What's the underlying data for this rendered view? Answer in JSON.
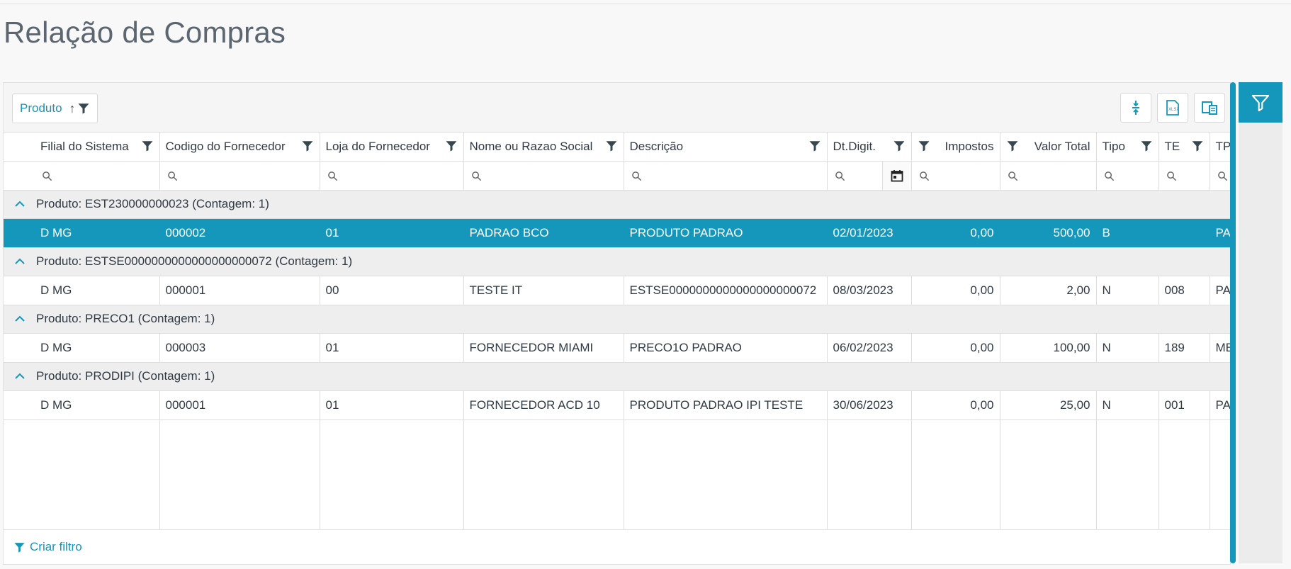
{
  "page": {
    "title": "Relação de Compras"
  },
  "toolbar": {
    "group_chip": {
      "label": "Produto",
      "sort_glyph": "↑"
    },
    "buttons": [
      "collapse-rows-icon",
      "export-xlsx-icon",
      "column-chooser-icon"
    ]
  },
  "grid": {
    "columns": [
      {
        "label": "Filial do Sistema"
      },
      {
        "label": "Codigo do Fornecedor"
      },
      {
        "label": "Loja do Fornecedor"
      },
      {
        "label": "Nome ou Razao Social"
      },
      {
        "label": "Descrição"
      },
      {
        "label": "Dt.Digit."
      },
      {
        "label": "Impostos"
      },
      {
        "label": "Valor Total"
      },
      {
        "label": "Tipo"
      },
      {
        "label": "TE"
      },
      {
        "label": "TP"
      }
    ],
    "groups": [
      {
        "label": "Produto: EST230000000023 (Contagem: 1)",
        "row": {
          "filial": "D MG",
          "codigo": "000002",
          "loja": "01",
          "nome": "PADRAO BCO",
          "descricao": "PRODUTO PADRAO",
          "dt": "02/01/2023",
          "impostos": "0,00",
          "valor": "500,00",
          "tipo": "B",
          "te": "",
          "tp": "PA"
        }
      },
      {
        "label": "Produto: ESTSE0000000000000000000072 (Contagem: 1)",
        "row": {
          "filial": "D MG",
          "codigo": "000001",
          "loja": "00",
          "nome": "TESTE IT",
          "descricao": "ESTSE0000000000000000000072",
          "dt": "08/03/2023",
          "impostos": "0,00",
          "valor": "2,00",
          "tipo": "N",
          "te": "008",
          "tp": "PA"
        }
      },
      {
        "label": "Produto: PRECO1 (Contagem: 1)",
        "row": {
          "filial": "D MG",
          "codigo": "000003",
          "loja": "01",
          "nome": "FORNECEDOR MIAMI",
          "descricao": "PRECO1O PADRAO",
          "dt": "06/02/2023",
          "impostos": "0,00",
          "valor": "100,00",
          "tipo": "N",
          "te": "189",
          "tp": "ME"
        }
      },
      {
        "label": "Produto: PRODIPI (Contagem: 1)",
        "row": {
          "filial": "D MG",
          "codigo": "000001",
          "loja": "01",
          "nome": "FORNECEDOR ACD 10",
          "descricao": "PRODUTO PADRAO IPI TESTE",
          "dt": "30/06/2023",
          "impostos": "0,00",
          "valor": "25,00",
          "tipo": "N",
          "te": "001",
          "tp": "PA"
        }
      }
    ]
  },
  "footer": {
    "create_filter": "Criar filtro"
  },
  "colors": {
    "accent": "#1597bb",
    "selected_row": "#1597bb",
    "group_row": "#eeeeee"
  }
}
